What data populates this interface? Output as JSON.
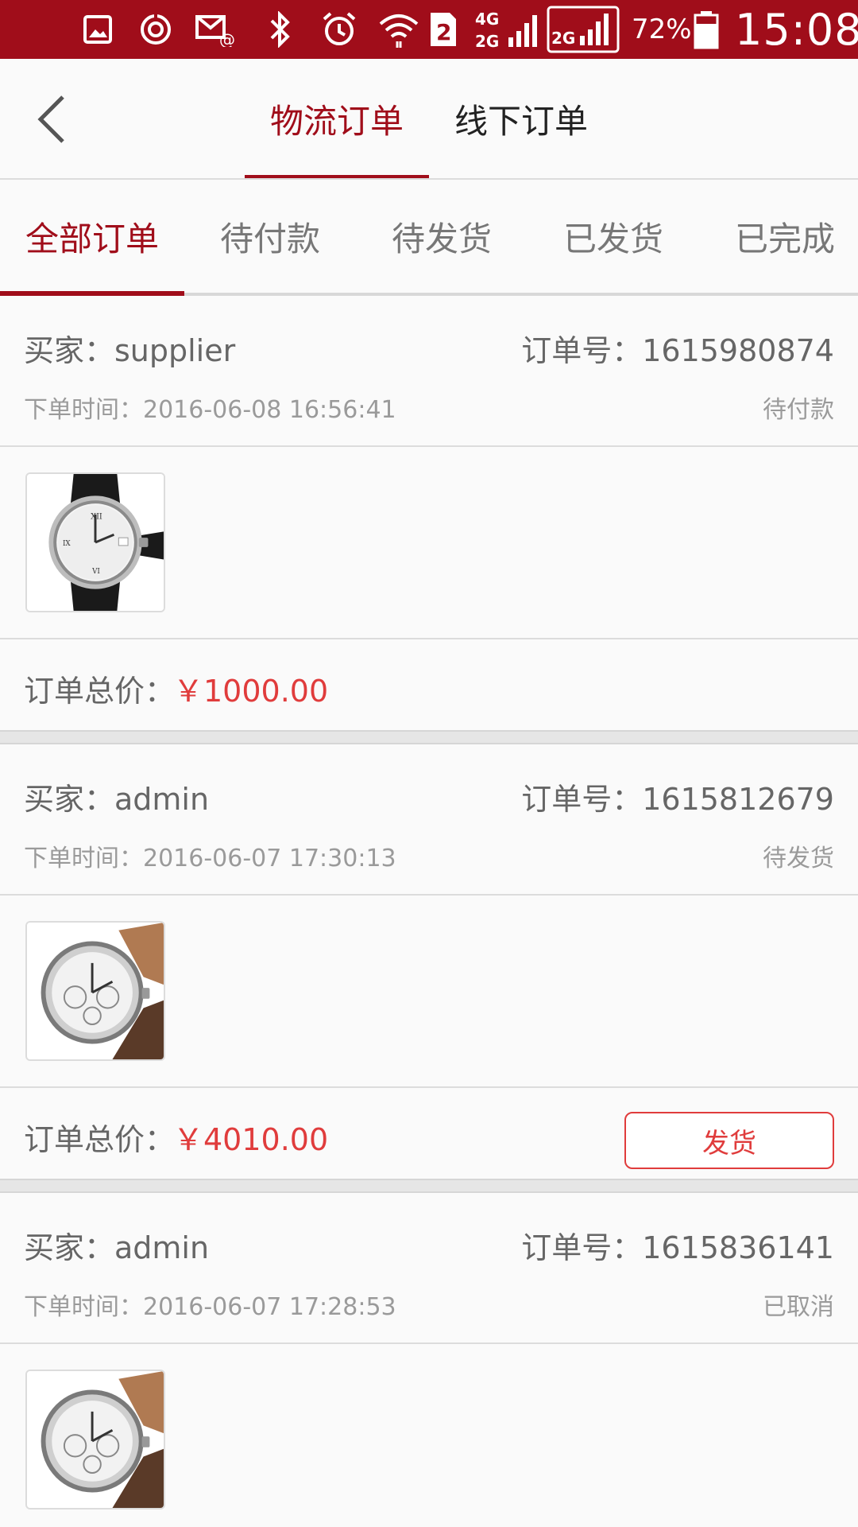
{
  "status_bar": {
    "battery": "72%",
    "time": "15:08",
    "icons": [
      "image-icon",
      "sync-icon",
      "mail-icon",
      "bluetooth-icon",
      "alarm-icon",
      "wifi-icon",
      "sim-2-icon",
      "signal-4g-2g-icon",
      "signal-2g-icon",
      "battery-icon"
    ]
  },
  "nav": {
    "back_icon": "chevron-left-icon",
    "tabs": [
      {
        "label": "物流订单",
        "active": true
      },
      {
        "label": "线下订单",
        "active": false
      }
    ]
  },
  "status_tabs": [
    {
      "label": "全部订单",
      "active": true
    },
    {
      "label": "待付款",
      "active": false
    },
    {
      "label": "待发货",
      "active": false
    },
    {
      "label": "已发货",
      "active": false
    },
    {
      "label": "已完成",
      "active": false
    }
  ],
  "colors": {
    "brand": "#a00d1a",
    "price": "#e03c3c",
    "muted_text": "#9a9a9a"
  },
  "orders": [
    {
      "buyer": "买家：supplier",
      "order_no": "订单号：1615980874",
      "time": "下单时间：2016-06-08 16:56:41",
      "state": "待付款",
      "product_image": "watch-dress-icon",
      "total_label": "订单总价：",
      "total_value": "￥1000.00",
      "action": null
    },
    {
      "buyer": "买家：admin",
      "order_no": "订单号：1615812679",
      "time": "下单时间：2016-06-07 17:30:13",
      "state": "待发货",
      "product_image": "watch-chrono-icon",
      "total_label": "订单总价：",
      "total_value": "￥4010.00",
      "action": "发货"
    },
    {
      "buyer": "买家：admin",
      "order_no": "订单号：1615836141",
      "time": "下单时间：2016-06-07 17:28:53",
      "state": "已取消",
      "product_image": "watch-chrono-icon",
      "total_label": "",
      "total_value": "",
      "action": null
    }
  ]
}
